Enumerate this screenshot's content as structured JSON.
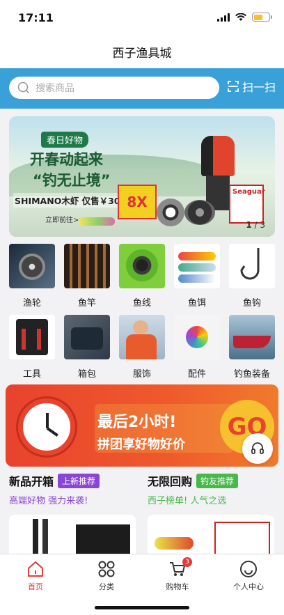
{
  "status": {
    "time": "17:11"
  },
  "nav": {
    "title": "西子渔具城"
  },
  "search": {
    "placeholder": "搜索商品",
    "scan_label": "扫一扫"
  },
  "banner": {
    "tag": "春日好物",
    "headline_1": "开春动起来",
    "headline_2": "“钓无止境”",
    "offer": "SHIMANO木虾 仅售￥30",
    "cta": "立即前往>>",
    "pager_current": "1",
    "pager_total": "/ 3",
    "box_brand": "Seaguar",
    "box_line_label": "8X"
  },
  "categories": [
    {
      "label": "渔轮",
      "icon": "reel"
    },
    {
      "label": "鱼竿",
      "icon": "rod"
    },
    {
      "label": "鱼线",
      "icon": "line"
    },
    {
      "label": "鱼饵",
      "icon": "lure"
    },
    {
      "label": "鱼钩",
      "icon": "hook"
    },
    {
      "label": "工具",
      "icon": "tools"
    },
    {
      "label": "箱包",
      "icon": "bag"
    },
    {
      "label": "服饰",
      "icon": "apparel"
    },
    {
      "label": "配件",
      "icon": "accessory"
    },
    {
      "label": "钓鱼装备",
      "icon": "boat"
    }
  ],
  "promo": {
    "line_1": "最后2小时!",
    "line_2": "拼团享好物好价",
    "go": "GO"
  },
  "sections": [
    {
      "title": "新品开箱",
      "badge": "上新推荐",
      "badge_color": "#8b45d6",
      "subtitle": "高端好物 强力来袭!",
      "subtitle_color": "#8b45d6"
    },
    {
      "title": "无限回购",
      "badge": "钓友推荐",
      "badge_color": "#49b84a",
      "subtitle": "西子榜单! 人气之选",
      "subtitle_color": "#49b84a"
    }
  ],
  "tabbar": {
    "items": [
      {
        "label": "首页",
        "active": true
      },
      {
        "label": "分类",
        "active": false
      },
      {
        "label": "购物车",
        "active": false,
        "badge": "3"
      },
      {
        "label": "个人中心",
        "active": false
      }
    ]
  },
  "colors": {
    "accent": "#3aa0d8",
    "active_tab": "#e23b3b"
  }
}
